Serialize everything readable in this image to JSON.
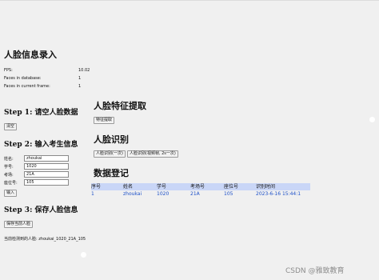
{
  "left_panel": {
    "title": "人脸信息录入",
    "stats": [
      {
        "label": "FPS:",
        "value": "10.02"
      },
      {
        "label": "Faces in database:",
        "value": "1"
      },
      {
        "label": "Faces in current frame:",
        "value": "1"
      }
    ],
    "step1": {
      "title": "Step 1: 请空人脸数据",
      "button": "清空"
    },
    "step2": {
      "title": "Step 2: 输入考生信息",
      "fields": [
        {
          "label": "姓名:",
          "value": "zhoukai"
        },
        {
          "label": "学号:",
          "value": "1020"
        },
        {
          "label": "考场:",
          "value": "21A"
        },
        {
          "label": "座位号:",
          "value": "105"
        }
      ],
      "button": "输入"
    },
    "step3": {
      "title": "Step 3: 保存人脸信息",
      "button": "保存当前人脸",
      "status": "当前检测到的人脸: zhoukai_1020_21A_105"
    }
  },
  "right_panel": {
    "feature_title": "人脸特征提取",
    "feature_button": "特征提取",
    "recog_title": "人脸识别",
    "recog_buttons": [
      "人脸识别(一次)",
      "人脸识别(视频帧, 2s一次)"
    ],
    "register_title": "数据登记",
    "table": {
      "headers": [
        "序号",
        "姓名",
        "学号",
        "考场号",
        "座位号",
        "识别时间"
      ],
      "rows": [
        [
          "1",
          "zhoukai",
          "1020",
          "21A",
          "105",
          "2023-6-16 15:44:1"
        ]
      ]
    }
  },
  "watermark": "CSDN @雅致教育"
}
